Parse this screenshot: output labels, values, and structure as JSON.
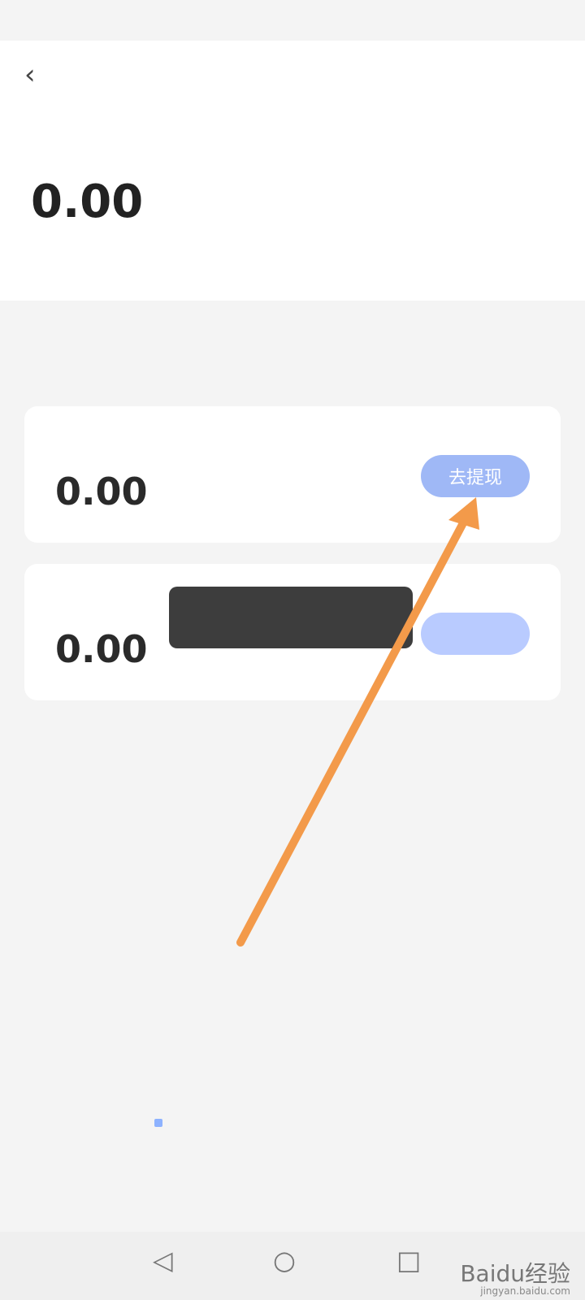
{
  "header": {
    "back_label": "‹",
    "title": ""
  },
  "summary": {
    "label": "",
    "amount": "0.00",
    "desc": ""
  },
  "section": {
    "title": ""
  },
  "cards": [
    {
      "label": "",
      "amount": "0.00",
      "button": "去提现"
    },
    {
      "label": "",
      "amount": "0.00",
      "button": ""
    }
  ],
  "toast": {
    "text": ""
  },
  "agreement": {
    "text": ""
  },
  "navbar": {
    "back_icon": "◁",
    "home_icon": "○",
    "recent_icon": "□"
  },
  "watermark": {
    "title": "Baidu经验",
    "url": "jingyan.baidu.com"
  },
  "colors": {
    "button": "#9fb8f6",
    "arrow": "#f39a4a"
  }
}
